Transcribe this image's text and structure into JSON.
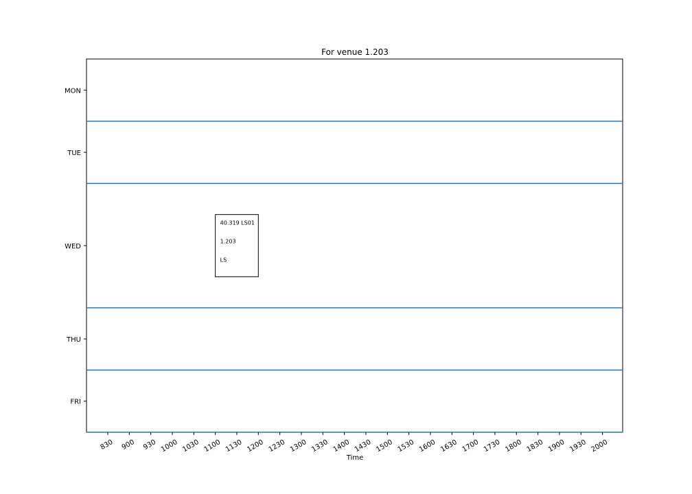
{
  "chart_data": {
    "type": "table",
    "title": "For venue 1.203",
    "xlabel": "Time",
    "ylabel": "",
    "x_ticks": [
      "830",
      "900",
      "930",
      "1000",
      "1030",
      "1100",
      "1130",
      "1200",
      "1230",
      "1300",
      "1330",
      "1400",
      "1430",
      "1500",
      "1530",
      "1600",
      "1630",
      "1700",
      "1730",
      "1800",
      "1830",
      "1900",
      "1930",
      "2000"
    ],
    "rows": [
      {
        "day": "MON",
        "span": 1
      },
      {
        "day": "TUE",
        "span": 1
      },
      {
        "day": "WED",
        "span": 2
      },
      {
        "day": "THU",
        "span": 1
      },
      {
        "day": "FRI",
        "span": 1
      }
    ],
    "separator_color": "#1f77b4",
    "events": [
      {
        "day": "WED",
        "start": "1100",
        "end": "1200",
        "lines": [
          "40.319 LS01",
          "1.203",
          "LS"
        ]
      }
    ]
  }
}
